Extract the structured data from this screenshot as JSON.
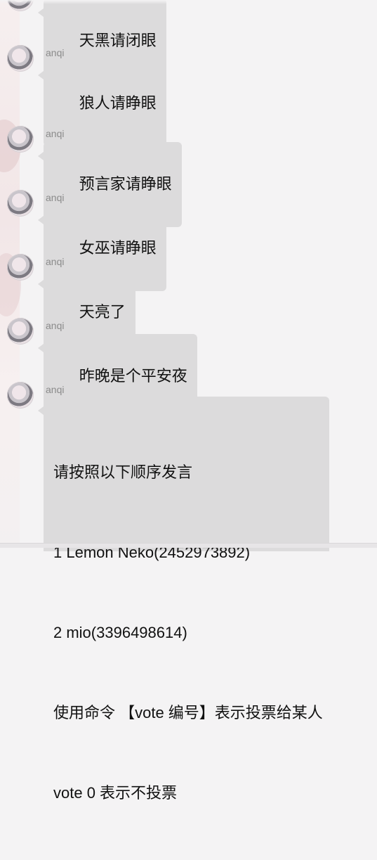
{
  "messages": [
    {
      "sender": "",
      "text": "天黑请闭眼",
      "lines": [
        "天黑请闭眼"
      ]
    },
    {
      "sender": "anqi",
      "text": "狼人请睁眼",
      "lines": [
        "狼人请睁眼"
      ]
    },
    {
      "sender": "anqi",
      "text": "预言家请睁眼",
      "lines": [
        "预言家请睁眼"
      ]
    },
    {
      "sender": "anqi",
      "text": "女巫请睁眼",
      "lines": [
        "女巫请睁眼"
      ]
    },
    {
      "sender": "anqi",
      "text": "天亮了",
      "lines": [
        "天亮了"
      ]
    },
    {
      "sender": "anqi",
      "text": "昨晚是个平安夜",
      "lines": [
        "昨晚是个平安夜"
      ]
    },
    {
      "sender": "anqi",
      "lines": [
        "请按照以下顺序发言",
        "1 Lemon Neko(2452973892)",
        "2 mio(3396498614)",
        "使用命令 【vote 编号】表示投票给某人",
        "vote 0 表示不投票"
      ]
    }
  ]
}
